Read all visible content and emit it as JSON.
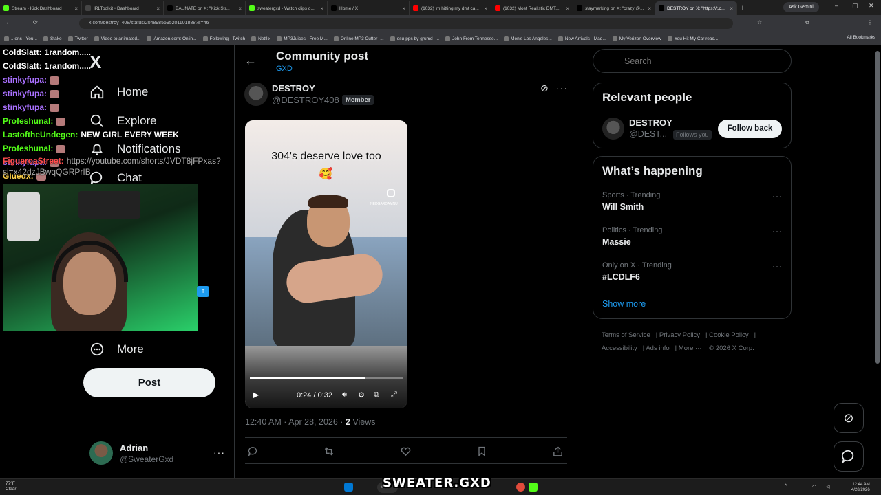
{
  "browser": {
    "tabs": [
      {
        "title": "Stream - Kick Dashboard",
        "color": "#53fc18"
      },
      {
        "title": "IRLToolkit • Dashboard",
        "color": "#444"
      },
      {
        "title": "BAUNATE on X: \"Kick Str...",
        "color": "#000"
      },
      {
        "title": "sweatergxd - Watch clips o...",
        "color": "#53fc18"
      },
      {
        "title": "Home / X",
        "color": "#000"
      },
      {
        "title": "(1032) im hitting my dmt ca...",
        "color": "#ff0000"
      },
      {
        "title": "(1032) Most Realistic DMT...",
        "color": "#ff0000"
      },
      {
        "title": "staymerking on X: \"crazy @...",
        "color": "#000"
      },
      {
        "title": "DESTROY on X: \"https://t.co...",
        "color": "#000"
      }
    ],
    "ask_gemini": "Ask Gemini",
    "url": "x.com/destroy_408/status/2048985595201101888?s=46",
    "bookmarks": [
      "...ons - You...",
      "Stake",
      "Twitter",
      "Video to animated...",
      "Amazon.com: Onlin...",
      "Following - Twitch",
      "Netflix",
      "MP3Juices - Free M...",
      "Online MP3 Cutter -...",
      "osu-pps by grumd -...",
      "John From Tennesse...",
      "Men's Los Angeles...",
      "New Arrivals - Mad...",
      "My Verizon Overview",
      "You Hit My Car reac..."
    ],
    "all_bookmarks": "All Bookmarks"
  },
  "nav": {
    "logo": "X",
    "items": [
      {
        "label": "Home",
        "icon": "home-icon"
      },
      {
        "label": "Explore",
        "icon": "search-icon"
      },
      {
        "label": "Notifications",
        "icon": "bell-icon"
      },
      {
        "label": "Chat",
        "icon": "chat-icon"
      },
      {
        "label": "More",
        "icon": "more-circle-icon"
      }
    ],
    "post_button": "Post",
    "account": {
      "name": "Adrian",
      "handle": "@SweaterGxd"
    }
  },
  "overlay": {
    "chat": [
      {
        "user": "ColdSlatt:",
        "msg": "1random.....",
        "color": "#ffffff"
      },
      {
        "user": "ColdSlatt:",
        "msg": "1random.....",
        "color": "#ffffff"
      },
      {
        "user": "stinkyfupa:",
        "msg": "",
        "color": "#a970ff"
      },
      {
        "user": "stinkyfupa:",
        "msg": "",
        "color": "#a970ff"
      },
      {
        "user": "stinkyfupa:",
        "msg": "",
        "color": "#a970ff"
      },
      {
        "user": "Profeshunal:",
        "msg": "",
        "color": "#53fc18"
      },
      {
        "user": "LastoftheUndegen:",
        "msg": "NEW GIRL EVERY WEEK",
        "color": "#53fc18"
      },
      {
        "user": "Profeshunal:",
        "msg": "",
        "color": "#53fc18"
      },
      {
        "user": "stinkyfupa:",
        "msg": "",
        "color": "#a970ff"
      },
      {
        "user": "Gluedx:",
        "msg": "",
        "color": "#ffd24a"
      }
    ],
    "link_user": "FigueroaStreet:",
    "link_text": "https://youtube.com/shorts/JVDT8jFPxas?si=x42dzJBwqQGRPrIB",
    "watermark": "SWEATER.GXD"
  },
  "post": {
    "header_title": "Community post",
    "community": "GXD",
    "author_name": "DESTROY",
    "author_handle": "@DESTROY408",
    "member_badge": "Member",
    "video": {
      "caption": "304's deserve love too",
      "emoji": "🥰",
      "ig_tag": "NEDGARDAMNU",
      "time": "0:24 / 0:32",
      "progress": 0.75
    },
    "timestamp": "12:40 AM · Apr 28, 2026 ·",
    "views_count": "2",
    "views_label": "Views"
  },
  "sidebar": {
    "search_placeholder": "Search",
    "relevant_title": "Relevant people",
    "relevant_person": {
      "name": "DESTROY",
      "handle": "@DEST...",
      "follows_you": "Follows you",
      "button": "Follow back"
    },
    "happening_title": "What’s happening",
    "trends": [
      {
        "meta": "Sports · Trending",
        "name": "Will Smith"
      },
      {
        "meta": "Politics · Trending",
        "name": "Massie"
      },
      {
        "meta": "Only on X · Trending",
        "name": "#LCDLF6"
      }
    ],
    "show_more": "Show more",
    "footer": [
      "Terms of Service",
      "Privacy Policy",
      "Cookie Policy",
      "Accessibility",
      "Ads info",
      "More ···",
      "© 2026 X Corp."
    ]
  },
  "taskbar": {
    "weather_temp": "77°F",
    "weather_desc": "Clear",
    "search": "Sear",
    "time": "12:44 AM",
    "date": "4/28/2026"
  }
}
